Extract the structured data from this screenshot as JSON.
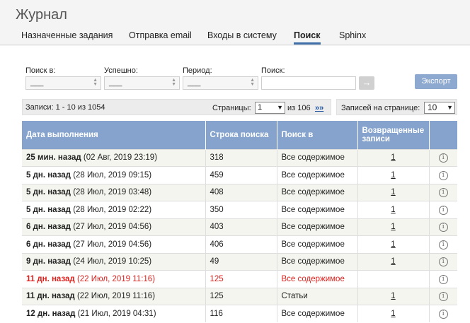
{
  "header": {
    "title": "Журнал",
    "tabs": [
      {
        "label": "Назначенные задания"
      },
      {
        "label": "Отправка email"
      },
      {
        "label": "Входы в систему"
      },
      {
        "label": "Поиск",
        "active": true
      },
      {
        "label": "Sphinx"
      }
    ]
  },
  "filters": {
    "search_in_label": "Поиск в:",
    "search_in_value": "___",
    "success_label": "Успешно:",
    "success_value": "___",
    "period_label": "Период:",
    "period_value": "___",
    "search_label": "Поиск:",
    "search_value": "",
    "go_icon": "arrow-right-icon",
    "export_label": "Экспорт"
  },
  "pager": {
    "records_info": "Записи: 1 - 10 из 1054",
    "pages_label": "Страницы:",
    "current_page": "1",
    "of_label": "из 106",
    "next_label": "»»",
    "per_page_label": "Записей на странице:",
    "per_page_value": "10"
  },
  "table": {
    "headers": {
      "date": "Дата выполнения",
      "query": "Строка поиска",
      "search_in": "Поиск в",
      "returned": "Возвращенные записи"
    },
    "rows": [
      {
        "rel": "25 мин. назад",
        "abs": "(02 Авг, 2019 23:19)",
        "query": "318",
        "where": "Все содержимое",
        "count": "1",
        "red": false
      },
      {
        "rel": "5 дн. назад",
        "abs": "(28 Июл, 2019 09:15)",
        "query": "459",
        "where": "Все содержимое",
        "count": "1",
        "red": false
      },
      {
        "rel": "5 дн. назад",
        "abs": "(28 Июл, 2019 03:48)",
        "query": "408",
        "where": "Все содержимое",
        "count": "1",
        "red": false
      },
      {
        "rel": "5 дн. назад",
        "abs": "(28 Июл, 2019 02:22)",
        "query": "350",
        "where": "Все содержимое",
        "count": "1",
        "red": false
      },
      {
        "rel": "6 дн. назад",
        "abs": "(27 Июл, 2019 04:56)",
        "query": "403",
        "where": "Все содержимое",
        "count": "1",
        "red": false
      },
      {
        "rel": "6 дн. назад",
        "abs": "(27 Июл, 2019 04:56)",
        "query": "406",
        "where": "Все содержимое",
        "count": "1",
        "red": false
      },
      {
        "rel": "9 дн. назад",
        "abs": "(24 Июл, 2019 10:25)",
        "query": "49",
        "where": "Все содержимое",
        "count": "1",
        "red": false
      },
      {
        "rel": "11 дн. назад",
        "abs": "(22 Июл, 2019 11:16)",
        "query": "125",
        "where": "Все содержимое",
        "count": "",
        "red": true
      },
      {
        "rel": "11 дн. назад",
        "abs": "(22 Июл, 2019 11:16)",
        "query": "125",
        "where": "Статьи",
        "count": "1",
        "red": false
      },
      {
        "rel": "12 дн. назад",
        "abs": "(21 Июл, 2019 04:31)",
        "query": "116",
        "where": "Все содержимое",
        "count": "1",
        "red": false
      }
    ],
    "info_icon": "info-icon"
  }
}
